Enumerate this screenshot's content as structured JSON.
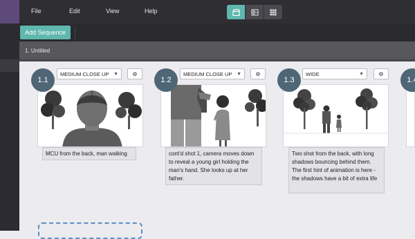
{
  "menu": {
    "file": "File",
    "edit": "Edit",
    "view": "View",
    "help": "Help"
  },
  "view_buttons": [
    {
      "icon": "clapperboard-icon",
      "active": true
    },
    {
      "icon": "storyboard-grid-icon",
      "active": false
    },
    {
      "icon": "tiles-icon",
      "active": false
    }
  ],
  "toolbar": {
    "add_sequence": "Add Sequence"
  },
  "sequence": {
    "title": "1. Untitled"
  },
  "shots": [
    {
      "number": "1.1",
      "shot_type": "MEDIUM CLOSE UP",
      "caption": "MCU from the back, man walking"
    },
    {
      "number": "1.2",
      "shot_type": "MEDIUM CLOSE UP",
      "caption": "cont'd shot 1, camera moves down to reveal a young girl holding the man's hand. She looks up at her father."
    },
    {
      "number": "1.3",
      "shot_type": "WIDE",
      "caption": "Two shot from the back, with long shadows bouncing behind them. The first hint of animation is here - the shadows have a bit of extra life"
    },
    {
      "number": "1.4"
    }
  ],
  "colors": {
    "accent": "#5fb7ad",
    "badge": "#4e6676",
    "left_accent": "#5d4a7a",
    "dashed": "#5b8fc4"
  }
}
